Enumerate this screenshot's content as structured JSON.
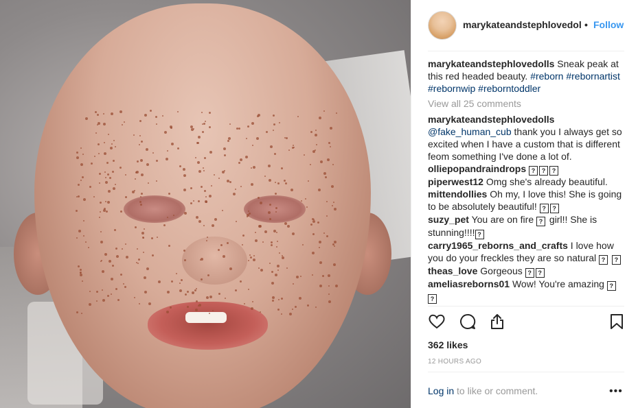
{
  "post": {
    "image": {
      "subject": "close-up photo of a reborn toddler doll head with freckles",
      "colors": {
        "skin": "#d7ab98",
        "background": "#8e8a8a",
        "freckle": "#9a4e34"
      }
    }
  },
  "header": {
    "username": "marykateandstephlovedol",
    "separator": "•",
    "follow_label": "Follow"
  },
  "caption": {
    "username": "marykateandstephlovedolls",
    "text": "Sneak peak at this red headed beauty.",
    "hashtags": [
      "#reborn",
      "#rebornartist",
      "#rebornwip",
      "#reborntoddler"
    ]
  },
  "view_all_label": "View all 25 comments",
  "comments": [
    {
      "user": "marykateandstephlovedolls",
      "mention": "@fake_human_cub",
      "text": "thank you I always get so excited when I have a custom that is different feom something I've done a lot of.",
      "emojis": ""
    },
    {
      "user": "olliepopandraindrops",
      "text": "",
      "emojis": "???"
    },
    {
      "user": "piperwest12",
      "text": "Omg she's already beautiful.",
      "emojis": ""
    },
    {
      "user": "mittendollies",
      "text": "Oh my, I love this! She is going to be absolutely beautiful!",
      "emojis": "??"
    },
    {
      "user": "suzy_pet",
      "text_before": "You are on fire",
      "mid_emoji": "?",
      "text": "girl!! She is stunning!!!!",
      "emojis": "?"
    },
    {
      "user": "carry1965_reborns_and_crafts",
      "text": "I love how you do your freckles they are so natural",
      "emojis": "??"
    },
    {
      "user": "theas_love",
      "text": "Gorgeous",
      "emojis": "??"
    },
    {
      "user": "ameliasreborns01",
      "text": "Wow! You're amazing",
      "emojis": "??"
    }
  ],
  "actions": {
    "like_icon": "heart-outline-icon",
    "comment_icon": "speech-bubble-icon",
    "share_icon": "share-upload-icon",
    "save_icon": "bookmark-icon"
  },
  "likes_label": "362 likes",
  "timestamp": "12 HOURS AGO",
  "login": {
    "link": "Log in",
    "rest": "to like or comment."
  },
  "more_label": "•••",
  "colors": {
    "link": "#003569",
    "follow": "#3897f0",
    "muted": "#999999",
    "text": "#262626"
  }
}
